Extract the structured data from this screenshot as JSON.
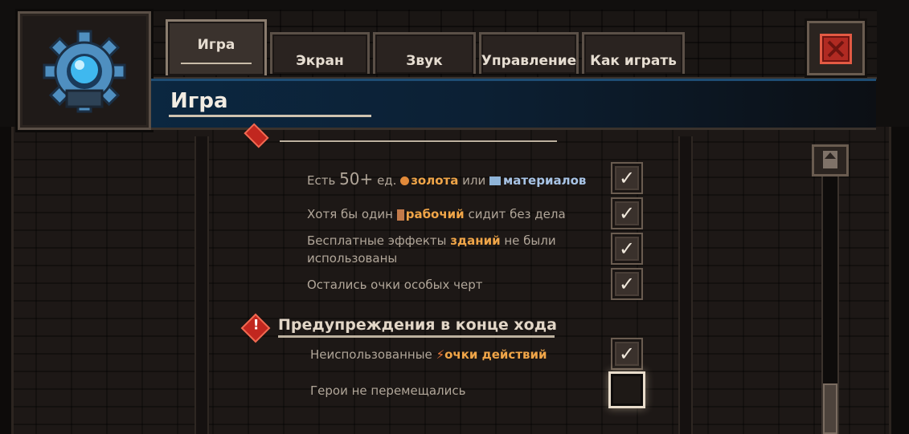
{
  "header": {
    "section_title": "Игра",
    "tabs": [
      {
        "label": "Игра",
        "active": true
      },
      {
        "label": "Экран",
        "active": false
      },
      {
        "label": "Звук",
        "active": false
      },
      {
        "label": "Управление",
        "active": false
      },
      {
        "label": "Как играть",
        "active": false
      }
    ],
    "close_icon": "close-icon",
    "settings_icon": "gear-icon"
  },
  "idle_rows": [
    {
      "text_parts": [
        "Есть ",
        "50+",
        " ед. ",
        "золота",
        " или ",
        "материалов"
      ],
      "checked": true
    },
    {
      "text_parts": [
        "Хотя бы один ",
        "рабочий",
        " сидит без дела"
      ],
      "checked": true
    },
    {
      "text_parts": [
        "Бесплатные эффекты ",
        "зданий",
        " не были",
        "использованы"
      ],
      "checked": true
    },
    {
      "text_parts": [
        "Остались очки особых черт"
      ],
      "checked": true
    }
  ],
  "end_turn_section": {
    "title": "Предупреждения в конце хода",
    "rows": [
      {
        "text_parts": [
          "Неиспользованные ",
          "очки действий"
        ],
        "checked": true
      },
      {
        "text_parts": [
          "Герои не перемещались"
        ],
        "checked": false
      }
    ]
  },
  "colors": {
    "accent_gold": "#f0a548",
    "accent_blue": "#a8c4e6",
    "close_red": "#b02a22",
    "header_blue": "#0b2740"
  }
}
